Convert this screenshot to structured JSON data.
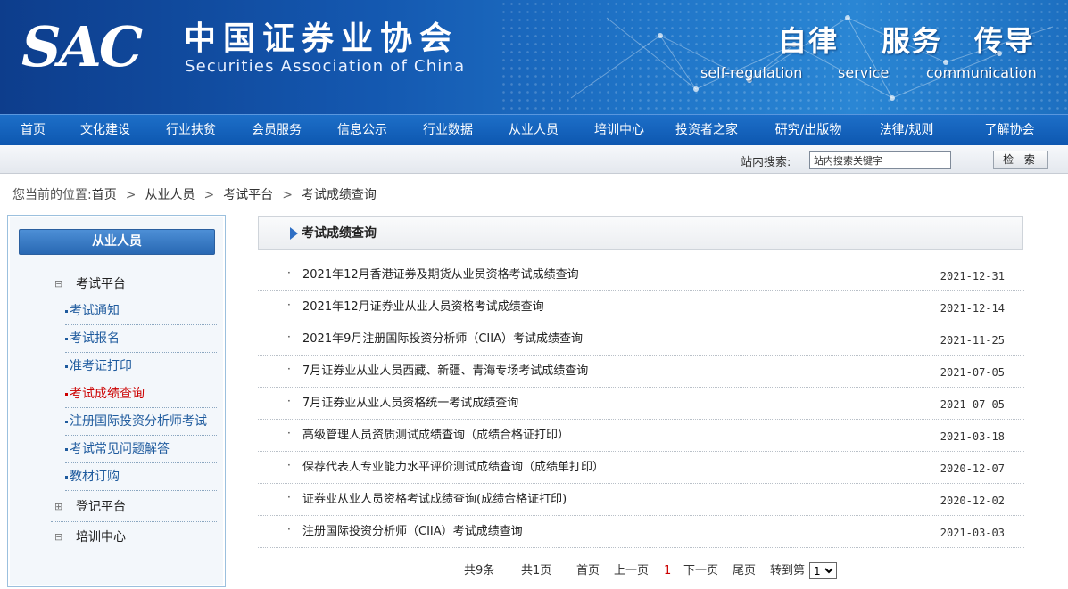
{
  "banner": {
    "logo": "SAC",
    "org_cn": "中国证券业协会",
    "org_en": "Securities Association of China",
    "slogans": [
      {
        "cn": "自律",
        "en": "self-regulation"
      },
      {
        "cn": "服务",
        "en": "service"
      },
      {
        "cn": "传导",
        "en": "communication"
      }
    ]
  },
  "nav": {
    "items": [
      "首页",
      "文化建设",
      "行业扶贫",
      "会员服务",
      "信息公示",
      "行业数据",
      "从业人员",
      "培训中心",
      "投资者之家",
      "研究/出版物",
      "法律/规则",
      "了解协会"
    ]
  },
  "search": {
    "label": "站内搜索:",
    "placeholder": "站内搜索关键字",
    "button": "检 索"
  },
  "breadcrumb": {
    "prefix": "您当前的位置:",
    "items": [
      "首页",
      "从业人员",
      "考试平台",
      "考试成绩查询"
    ]
  },
  "sidebar": {
    "header": "从业人员",
    "groups": [
      {
        "toggle": "⊟",
        "label": "考试平台"
      },
      {
        "toggle": "⊞",
        "label": "登记平台"
      },
      {
        "toggle": "⊟",
        "label": "培训中心"
      }
    ],
    "links": [
      "考试通知",
      "考试报名",
      "准考证打印",
      "考试成绩查询",
      "注册国际投资分析师考试",
      "考试常见问题解答",
      "教材订购"
    ],
    "active_link": "考试成绩查询"
  },
  "main": {
    "title": "考试成绩查询",
    "rows": [
      {
        "title": "2021年12月香港证券及期货从业员资格考试成绩查询",
        "date": "2021-12-31"
      },
      {
        "title": "2021年12月证券业从业人员资格考试成绩查询",
        "date": "2021-12-14"
      },
      {
        "title": "2021年9月注册国际投资分析师（CIIA）考试成绩查询",
        "date": "2021-11-25"
      },
      {
        "title": "7月证券业从业人员西藏、新疆、青海专场考试成绩查询",
        "date": "2021-07-05"
      },
      {
        "title": "7月证券业从业人员资格统一考试成绩查询",
        "date": "2021-07-05"
      },
      {
        "title": "高级管理人员资质测试成绩查询（成绩合格证打印）",
        "date": "2021-03-18"
      },
      {
        "title": "保荐代表人专业能力水平评价测试成绩查询（成绩单打印）",
        "date": "2020-12-07"
      },
      {
        "title": "证券业从业人员资格考试成绩查询(成绩合格证打印)",
        "date": "2020-12-02"
      },
      {
        "title": "注册国际投资分析师（CIIA）考试成绩查询",
        "date": "2021-03-03"
      }
    ]
  },
  "pager": {
    "total": "共9条",
    "pages": "共1页",
    "first": "首页",
    "prev": "上一页",
    "current": "1",
    "next": "下一页",
    "last": "尾页",
    "goto": "转到第",
    "select_value": "1"
  },
  "colors": {
    "nav_bg": "#0d57b0",
    "link": "#1f5b9e",
    "active": "#cc0000"
  }
}
